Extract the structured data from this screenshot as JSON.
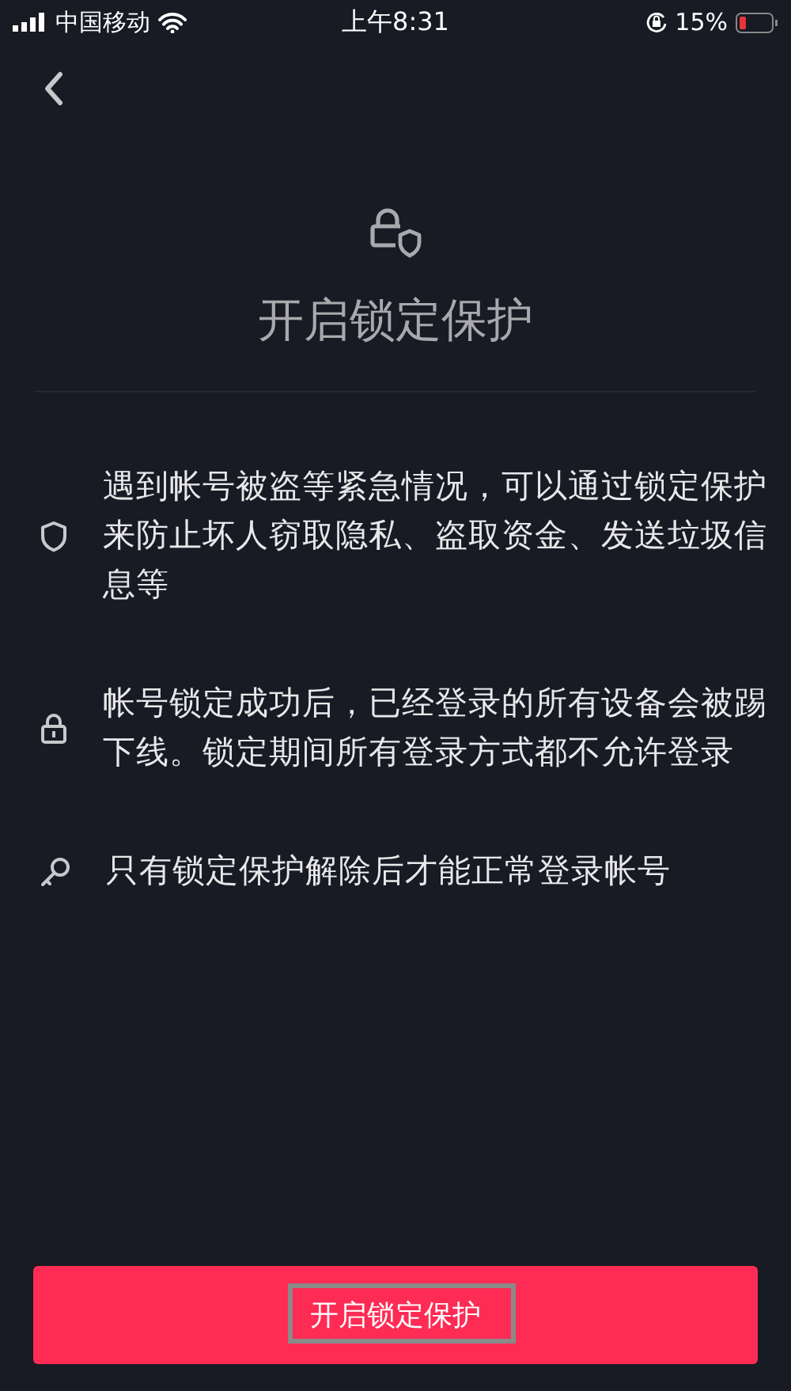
{
  "status_bar": {
    "carrier": "中国移动",
    "time": "上午8:31",
    "battery": "15%"
  },
  "title": "开启锁定保护",
  "items": [
    {
      "kind": "shield",
      "text": "遇到帐号被盗等紧急情况，可以通过锁定保护来防止坏人窃取隐私、盗取资金、发送垃圾信息等"
    },
    {
      "kind": "lock",
      "text": "帐号锁定成功后，已经登录的所有设备会被踢下线。锁定期间所有登录方式都不允许登录"
    },
    {
      "kind": "key",
      "text": "只有锁定保护解除后才能正常登录帐号"
    }
  ],
  "button": {
    "label": "开启锁定保护",
    "highlighted": true
  }
}
